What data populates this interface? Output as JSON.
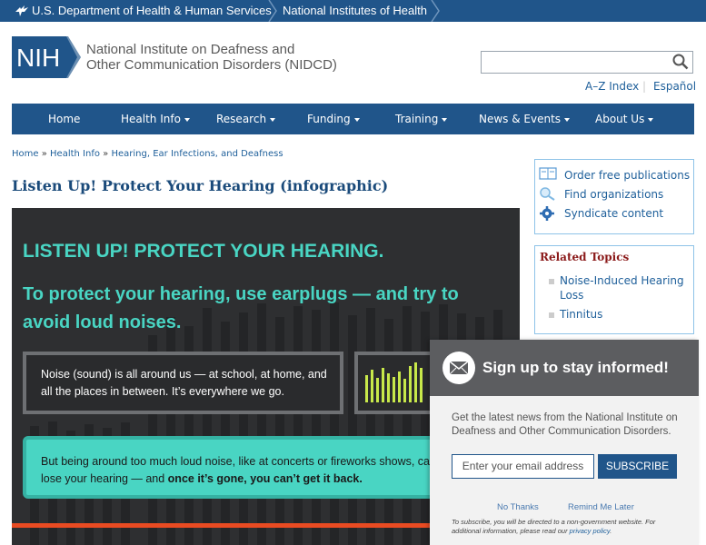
{
  "topbar": {
    "hhs_label": "U.S. Department of Health & Human Services",
    "nih_label": "National Institutes of Health"
  },
  "header": {
    "logo_text": "NIH",
    "institute_line1": "National Institute on Deafness and",
    "institute_line2": "Other Communication Disorders (NIDCD)",
    "search_value": "",
    "az_index": "A–Z Index",
    "espanol": "Español"
  },
  "nav": {
    "items": [
      {
        "label": "Home"
      },
      {
        "label": "Health Info"
      },
      {
        "label": "Research"
      },
      {
        "label": "Funding"
      },
      {
        "label": "Training"
      },
      {
        "label": "News & Events"
      },
      {
        "label": "About Us"
      }
    ]
  },
  "breadcrumb": {
    "items": [
      "Home",
      "Health Info",
      "Hearing, Ear Infections, and Deafness"
    ],
    "separator": "»"
  },
  "page": {
    "title": "Listen Up! Protect Your Hearing (infographic)"
  },
  "infographic": {
    "heading": "LISTEN UP! PROTECT YOUR HEARING.",
    "subheading": "To protect your hearing, use earplugs — and try to avoid loud noises.",
    "box1_line1": "Noise (sound) is all around us — at school, at home, and",
    "box1_line2": "all the places in between. It’s everywhere we go.",
    "box3_line1": "But being around too much loud noise, like at concerts or fireworks shows, ca",
    "box3_line2_prefix": "lose your hearing — and ",
    "box3_line2_bold": "once it’s gone, you can’t get it back."
  },
  "sidebar": {
    "resources": [
      {
        "label": "Order free publications",
        "icon": "publications-icon"
      },
      {
        "label": "Find organizations",
        "icon": "magnifier-icon"
      },
      {
        "label": "Syndicate content",
        "icon": "gear-icon"
      }
    ],
    "related_title": "Related Topics",
    "related_line1a": "Noise-Induced Hearing",
    "related_line1b": "Loss",
    "related_item2": "Tinnitus"
  },
  "modal": {
    "title": "Sign up to stay informed!",
    "desc_line1": "Get the latest news from the National Institute on",
    "desc_line2": "Deafness and Other Communication Disorders.",
    "email_placeholder": "Enter your email address",
    "subscribe_label": "SUBSCRIBE",
    "no_thanks": "No Thanks",
    "remind_later": "Remind Me Later",
    "footnote_line1": "To subscribe, you will be directed to a non-government website. For",
    "footnote_line2_prefix": "additional information, please read our ",
    "footnote_link": "privacy policy",
    "footnote_end": "."
  },
  "colors": {
    "nav_blue": "#20558a",
    "link_blue": "#1e5f9a",
    "teal": "#49d5c3",
    "infographic_bg": "#2e2f31",
    "accent_red": "#e94b22",
    "meter_green": "#c8e84a",
    "modal_header": "#5c5d60"
  }
}
